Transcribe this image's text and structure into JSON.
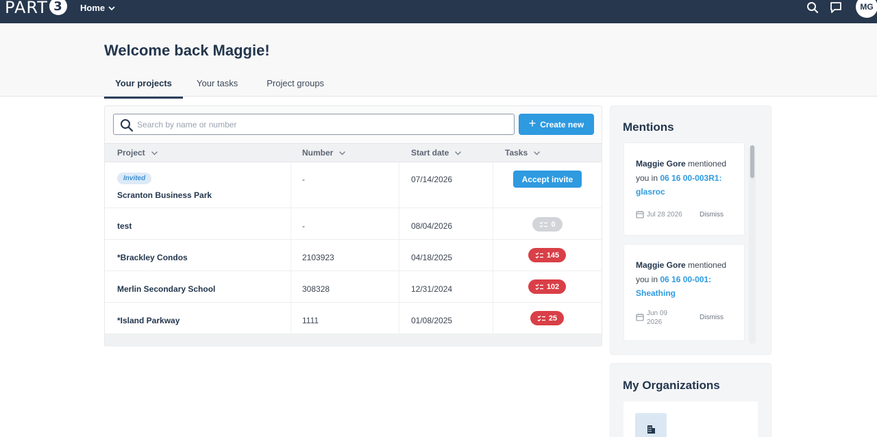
{
  "nav": {
    "brand_text": "PART",
    "brand_badge": "3",
    "home_label": "Home",
    "avatar_initials": "MG"
  },
  "header": {
    "welcome": "Welcome back Maggie!",
    "tabs": [
      {
        "label": "Your projects",
        "active": true
      },
      {
        "label": "Your tasks",
        "active": false
      },
      {
        "label": "Project groups",
        "active": false
      }
    ]
  },
  "projects": {
    "search_placeholder": "Search by name or number",
    "create_label": "Create new",
    "columns": [
      "Project",
      "Number",
      "Start date",
      "Tasks"
    ],
    "invited_label": "Invited",
    "accept_label": "Accept invite",
    "rows": [
      {
        "name": "Scranton Business Park",
        "number": "-",
        "start_date": "07/14/2026",
        "tasks": null,
        "invited": true
      },
      {
        "name": "test",
        "number": "-",
        "start_date": "08/04/2026",
        "tasks": "0",
        "invited": false
      },
      {
        "name": "*Brackley Condos",
        "number": "2103923",
        "start_date": "04/18/2025",
        "tasks": "145",
        "invited": false
      },
      {
        "name": "Merlin Secondary School",
        "number": "308328",
        "start_date": "12/31/2024",
        "tasks": "102",
        "invited": false
      },
      {
        "name": "*Island Parkway",
        "number": "1111",
        "start_date": "01/08/2025",
        "tasks": "25",
        "invited": false
      }
    ]
  },
  "mentions": {
    "title": "Mentions",
    "items": [
      {
        "author": "Maggie Gore",
        "verb": "mentioned",
        "prep": "you in",
        "link": "06 16 00-003R1: glasroc",
        "date": "Jul 28 2026",
        "dismiss": "Dismiss"
      },
      {
        "author": "Maggie Gore",
        "verb": "mentioned",
        "prep": "you in",
        "link": "06 16 00-001: Sheathing",
        "date": "Jun 09 2026",
        "dismiss": "Dismiss"
      }
    ]
  },
  "organizations": {
    "title": "My Organizations"
  },
  "colors": {
    "nav_bg": "#26374e",
    "accent_blue": "#2e9ae0",
    "task_red": "#d93f47",
    "task_grey": "#d1d4d8"
  }
}
